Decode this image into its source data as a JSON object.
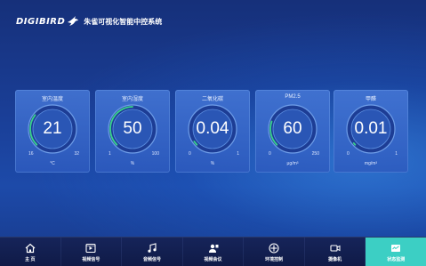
{
  "header": {
    "logo": "DIGIBIRD",
    "title": "朱雀可视化智能中控系统"
  },
  "gauges": [
    {
      "title": "室内温度",
      "value": "21",
      "min": "16",
      "max": "32",
      "unit": "°C",
      "fraction": 0.31
    },
    {
      "title": "室内湿度",
      "value": "50",
      "min": "1",
      "max": "100",
      "unit": "%",
      "fraction": 0.5
    },
    {
      "title": "二氧化碳",
      "value": "0.04",
      "min": "0",
      "max": "1",
      "unit": "%",
      "fraction": 0.04
    },
    {
      "title": "PM2.5",
      "value": "60",
      "min": "0",
      "max": "250",
      "unit": "μg/m³",
      "fraction": 0.24
    },
    {
      "title": "甲醛",
      "value": "0.01",
      "min": "0",
      "max": "1",
      "unit": "mg/m³",
      "fraction": 0.01
    }
  ],
  "nav": [
    {
      "label": "主 页",
      "icon": "home-icon",
      "active": false
    },
    {
      "label": "视频信号",
      "icon": "video-signal-icon",
      "active": false
    },
    {
      "label": "音频信号",
      "icon": "music-note-icon",
      "active": false
    },
    {
      "label": "视频会议",
      "icon": "video-conference-icon",
      "active": false
    },
    {
      "label": "环境控制",
      "icon": "environment-control-icon",
      "active": false
    },
    {
      "label": "摄像机",
      "icon": "camera-icon",
      "active": false
    },
    {
      "label": "状态监测",
      "icon": "status-monitor-icon",
      "active": true
    }
  ],
  "colors": {
    "active_tab": "#3ccfc4",
    "gauge_arc": "#39d38a",
    "background": "#1a3f98"
  }
}
